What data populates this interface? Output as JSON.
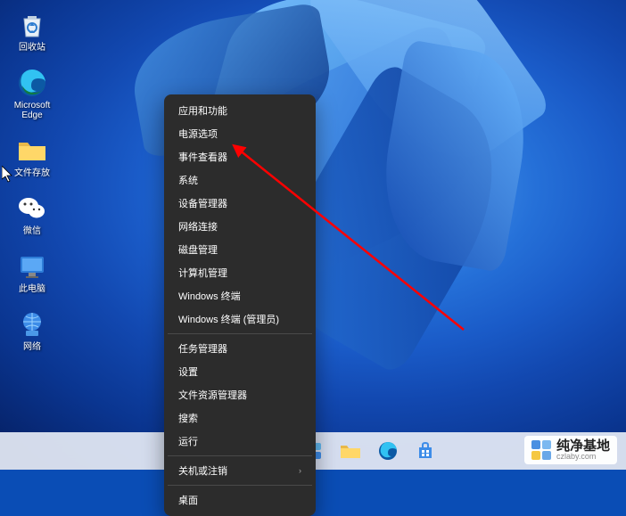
{
  "desktop": {
    "icons": [
      {
        "name": "recycle-bin",
        "label": "回收站"
      },
      {
        "name": "edge",
        "label": "Microsoft Edge"
      },
      {
        "name": "folder",
        "label": "文件存放"
      },
      {
        "name": "wechat",
        "label": "微信"
      },
      {
        "name": "this-pc",
        "label": "此电脑"
      },
      {
        "name": "network",
        "label": "网络"
      }
    ]
  },
  "context_menu": {
    "groups": [
      [
        {
          "label": "应用和功能",
          "submenu": false
        },
        {
          "label": "电源选项",
          "submenu": false
        },
        {
          "label": "事件查看器",
          "submenu": false
        },
        {
          "label": "系统",
          "submenu": false
        },
        {
          "label": "设备管理器",
          "submenu": false
        },
        {
          "label": "网络连接",
          "submenu": false
        },
        {
          "label": "磁盘管理",
          "submenu": false
        },
        {
          "label": "计算机管理",
          "submenu": false
        },
        {
          "label": "Windows 终端",
          "submenu": false
        },
        {
          "label": "Windows 终端 (管理员)",
          "submenu": false
        }
      ],
      [
        {
          "label": "任务管理器",
          "submenu": false
        },
        {
          "label": "设置",
          "submenu": false
        },
        {
          "label": "文件资源管理器",
          "submenu": false
        },
        {
          "label": "搜索",
          "submenu": false
        },
        {
          "label": "运行",
          "submenu": false
        }
      ],
      [
        {
          "label": "关机或注销",
          "submenu": true
        }
      ],
      [
        {
          "label": "桌面",
          "submenu": false
        }
      ]
    ]
  },
  "taskbar": {
    "items": [
      "start",
      "search",
      "task-view",
      "widgets",
      "explorer",
      "edge",
      "store"
    ]
  },
  "watermark": {
    "main": "纯净基地",
    "sub": "czlaby.com"
  }
}
